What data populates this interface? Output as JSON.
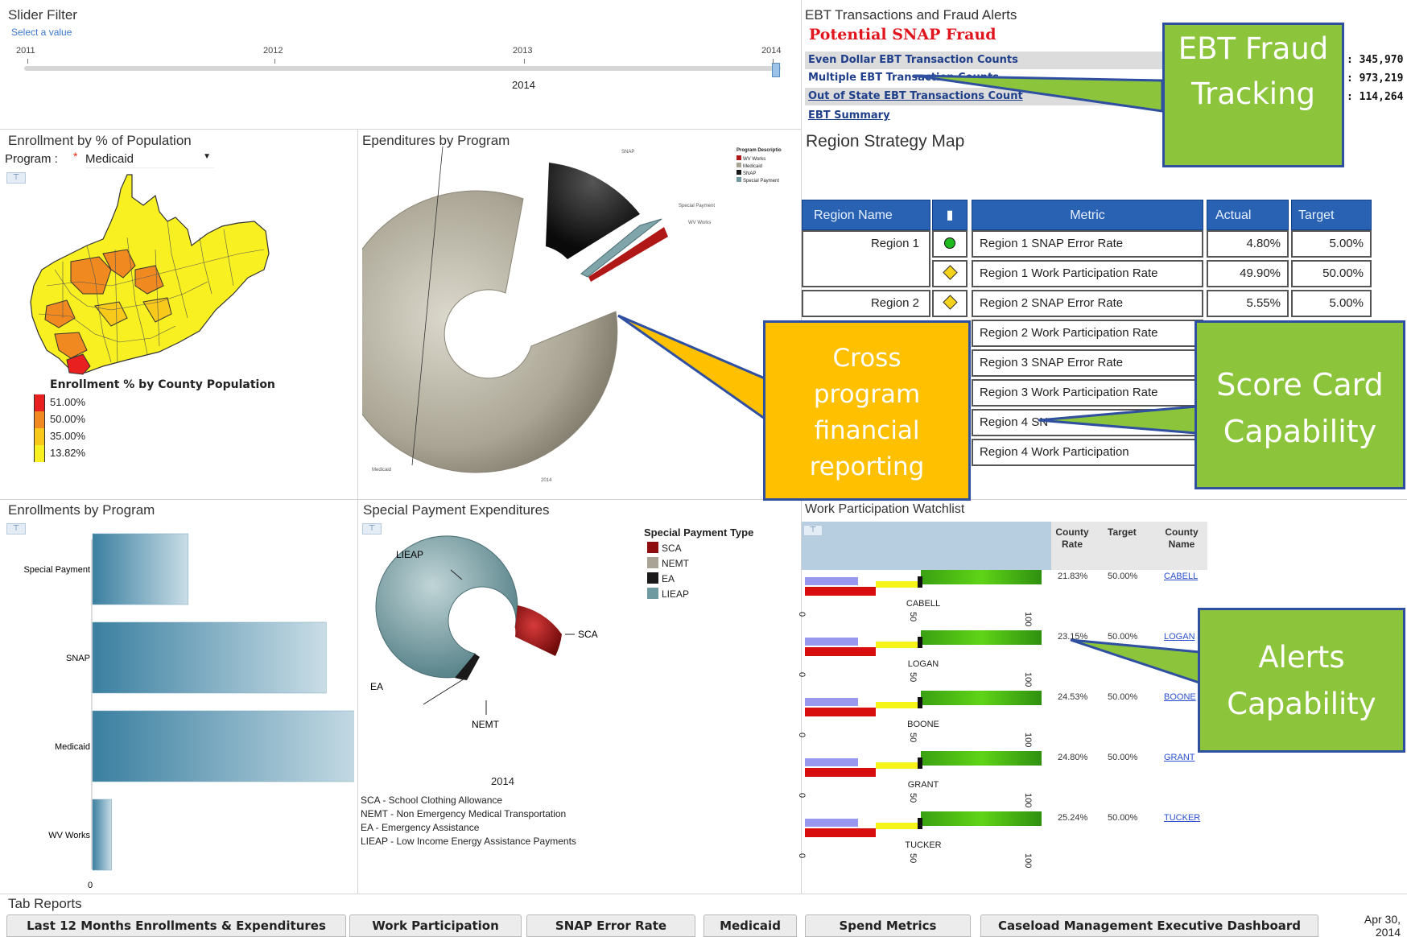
{
  "slider": {
    "title": "Slider Filter",
    "hint": "Select a value",
    "ticks": [
      "2011",
      "2012",
      "2013",
      "2014"
    ],
    "selected": "2014"
  },
  "ebt": {
    "title": "EBT Transactions and Fraud Alerts",
    "alert": "Potential SNAP Fraud",
    "rows": [
      {
        "label": "Even Dollar EBT Transaction Counts",
        "value": ": 345,970"
      },
      {
        "label": "Multiple EBT Transaction Counts",
        "value": ": 973,219"
      },
      {
        "label": "Out of State EBT Transactions Count",
        "value": ": 114,264"
      }
    ],
    "summary_link": "EBT Summary"
  },
  "enrollment_map": {
    "title": "Enrollment by % of Population",
    "program_label": "Program :",
    "program_value": "Medicaid",
    "legend_title": "Enrollment % by County Population",
    "legend": [
      {
        "label": "51.00%",
        "color": "#e82020"
      },
      {
        "label": "50.00%",
        "color": "#f08a20"
      },
      {
        "label": "35.00%",
        "color": "#f8c81a"
      },
      {
        "label": "13.82%",
        "color": "#f8f020"
      }
    ]
  },
  "expenditures": {
    "title": "Ependitures by Program",
    "legend_title": "Program Descriptio",
    "legend": [
      {
        "label": "WV Works",
        "color": "#b01818"
      },
      {
        "label": "Medicaid",
        "color": "#a8a394"
      },
      {
        "label": "SNAP",
        "color": "#1a1a1a"
      },
      {
        "label": "Special Payment",
        "color": "#6f9aa0"
      }
    ],
    "labels": {
      "snap": "SNAP",
      "special": "Special Payment",
      "wvworks": "WV Works",
      "medicaid": "Medicaid",
      "year": "2014"
    }
  },
  "strategy": {
    "title": "Region Strategy Map",
    "headers": [
      "Region Name",
      "Metric",
      "Actual",
      "Target"
    ],
    "rows": [
      {
        "region": "Region 1",
        "status": "green",
        "metric": "Region 1 SNAP Error Rate",
        "actual": "4.80%",
        "target": "5.00%"
      },
      {
        "region": "",
        "status": "yellow",
        "metric": "Region 1 Work Participation Rate",
        "actual": "49.90%",
        "target": "50.00%"
      },
      {
        "region": "Region 2",
        "status": "yellow",
        "metric": "Region 2 SNAP Error Rate",
        "actual": "5.55%",
        "target": "5.00%"
      },
      {
        "metric": "Region 2 Work Participation Rate"
      },
      {
        "metric": "Region 3 SNAP Error Rate"
      },
      {
        "metric": "Region 3 Work Participation Rate"
      },
      {
        "metric": "Region 4 SN"
      },
      {
        "metric": "Region 4 Work Participation"
      }
    ]
  },
  "enrollments_by_program": {
    "title": "Enrollments by Program",
    "axis_zero": "0"
  },
  "special_payment": {
    "title": "Special Payment Expenditures",
    "legend_title": "Special Payment Type",
    "legend": [
      {
        "label": "SCA",
        "color": "#8e0c10"
      },
      {
        "label": "NEMT",
        "color": "#a8a394"
      },
      {
        "label": "EA",
        "color": "#1a1a1a"
      },
      {
        "label": "LIEAP",
        "color": "#6f9aa0"
      }
    ],
    "year": "2014",
    "notes": [
      "SCA - School Clothing Allowance",
      "NEMT - Non Emergency Medical Transportation",
      "EA - Emergency Assistance",
      "LIEAP - Low Income Energy Assistance Payments"
    ]
  },
  "watchlist": {
    "title": "Work Participation Watchlist",
    "headers": {
      "rate": "County Rate",
      "target": "Target",
      "name": "County Name"
    },
    "rows": [
      {
        "county": "CABELL",
        "rate": "21.83%",
        "target": "50.00%",
        "name": "CABELL",
        "rate_value": 21.83
      },
      {
        "county": "LOGAN",
        "rate": "23.15%",
        "target": "50.00%",
        "name": "LOGAN",
        "rate_value": 23.15
      },
      {
        "county": "BOONE",
        "rate": "24.53%",
        "target": "50.00%",
        "name": "BOONE",
        "rate_value": 24.53
      },
      {
        "county": "GRANT",
        "rate": "24.80%",
        "target": "50.00%",
        "name": "GRANT",
        "rate_value": 24.8
      },
      {
        "county": "TUCKER",
        "rate": "25.24%",
        "target": "50.00%",
        "name": "TUCKER",
        "rate_value": 25.24
      }
    ],
    "scale": [
      "0",
      "50",
      "100"
    ]
  },
  "callouts": {
    "ebt": "EBT Fraud Tracking",
    "cross": "Cross program financial reporting",
    "scorecard": "Score Card Capability",
    "alerts": "Alerts Capability"
  },
  "tabs": {
    "title": "Tab Reports",
    "items": [
      "Last 12 Months Enrollments & Expenditures",
      "Work Participation",
      "SNAP Error Rate",
      "Medicaid",
      "Spend Metrics",
      "Caseload Management Executive Dashboard"
    ],
    "date": "Apr 30, 2014"
  },
  "chart_data": [
    {
      "type": "bar",
      "title": "Enrollments by Program",
      "categories": [
        "Special Payment",
        "SNAP",
        "Medicaid",
        "WV Works"
      ],
      "values": [
        90,
        220,
        258,
        18
      ],
      "xlabel": "",
      "ylabel": ""
    },
    {
      "type": "pie",
      "title": "Ependitures by Program",
      "categories": [
        "Medicaid",
        "SNAP",
        "Special Payment",
        "WV Works"
      ],
      "values": [
        81,
        14,
        3,
        2
      ]
    },
    {
      "type": "pie",
      "title": "Special Payment Expenditures",
      "categories": [
        "SCA",
        "NEMT",
        "EA",
        "LIEAP"
      ],
      "values": [
        17,
        0,
        3,
        80
      ]
    }
  ]
}
